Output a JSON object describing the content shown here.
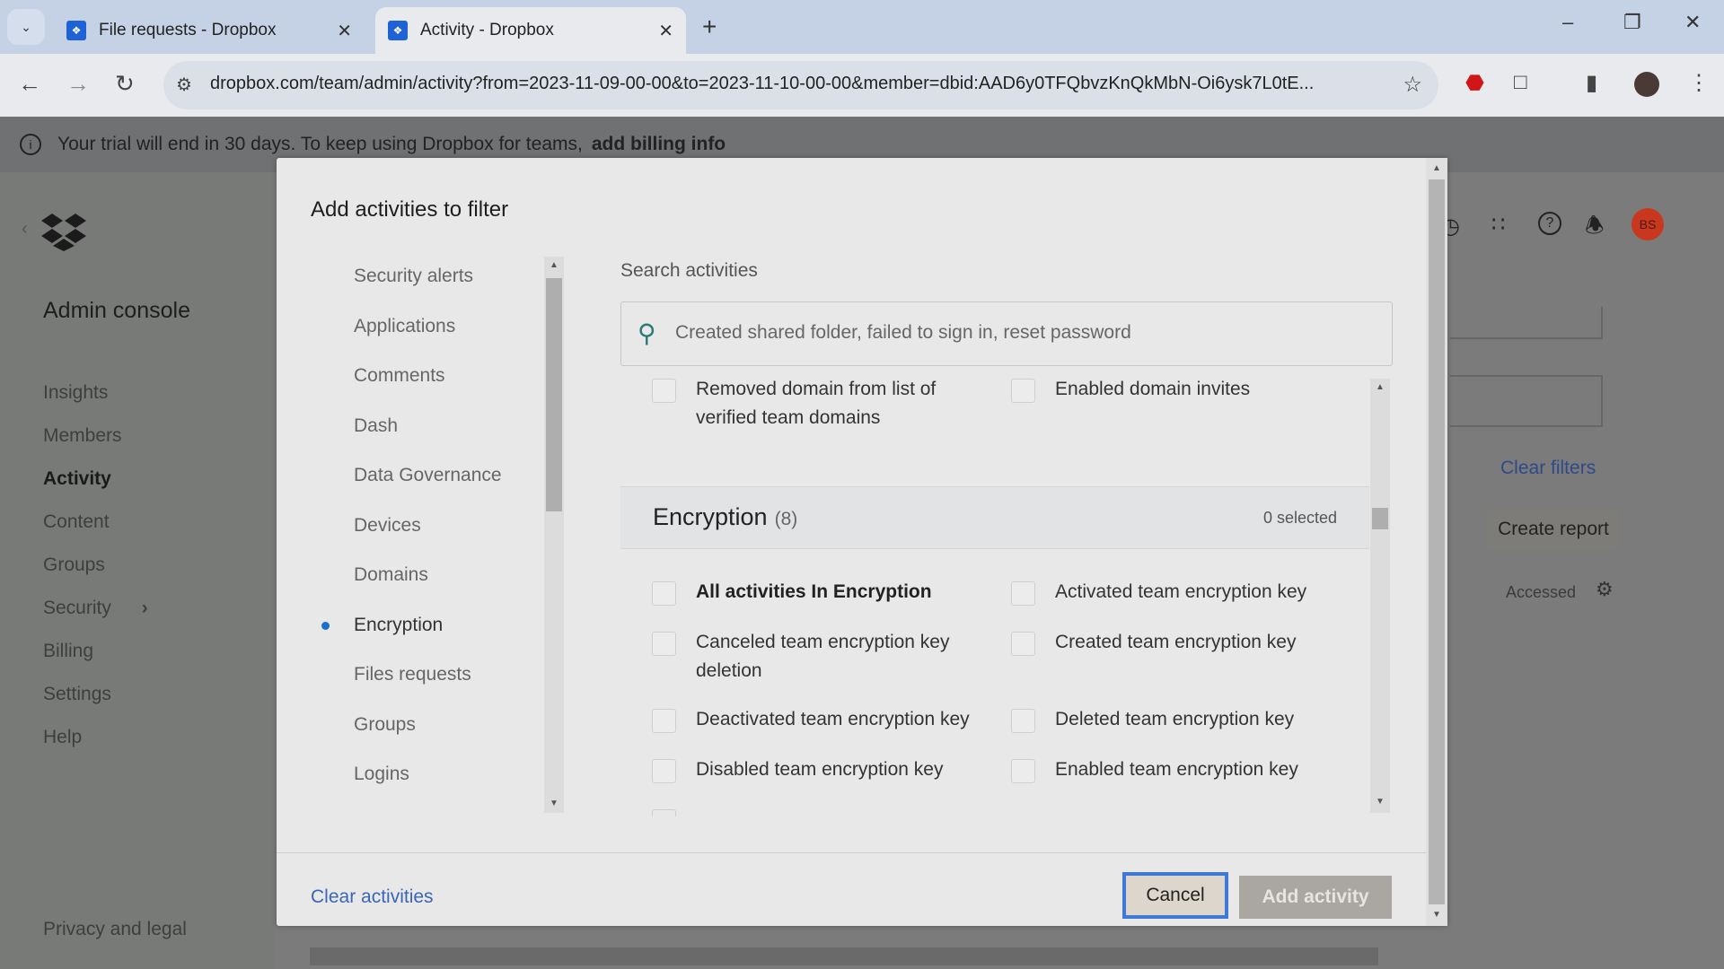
{
  "browser": {
    "tabs": [
      {
        "title": "File requests - Dropbox",
        "active": false
      },
      {
        "title": "Activity - Dropbox",
        "active": true
      }
    ],
    "url": "dropbox.com/team/admin/activity?from=2023-11-09-00-00&to=2023-11-10-00-00&member=dbid:AAD6y0TFQbvzKnQkMbN-Oi6ysk7L0tE..."
  },
  "banner": {
    "text": "Your trial will end in 30 days. To keep using Dropbox for teams,",
    "link": "add billing info"
  },
  "sidebar": {
    "title": "Admin console",
    "items": [
      {
        "label": "Insights"
      },
      {
        "label": "Members"
      },
      {
        "label": "Activity",
        "active": true
      },
      {
        "label": "Content"
      },
      {
        "label": "Groups"
      },
      {
        "label": "Security",
        "has_chevron": true
      },
      {
        "label": "Billing"
      },
      {
        "label": "Settings"
      },
      {
        "label": "Help"
      }
    ],
    "footer": "Privacy and legal"
  },
  "background_page": {
    "clear_filters": "Clear filters",
    "create_report": "Create report",
    "column_accessed": "Accessed",
    "avatar_initials": "BS",
    "avatar_color": "#c9371e"
  },
  "modal": {
    "title": "Add activities to filter",
    "categories": [
      {
        "label": "Security alerts"
      },
      {
        "label": "Applications"
      },
      {
        "label": "Comments"
      },
      {
        "label": "Dash"
      },
      {
        "label": "Data Governance"
      },
      {
        "label": "Devices"
      },
      {
        "label": "Domains"
      },
      {
        "label": "Encryption",
        "active": true
      },
      {
        "label": "Files requests"
      },
      {
        "label": "Groups"
      },
      {
        "label": "Logins"
      }
    ],
    "search": {
      "label": "Search activities",
      "placeholder": "Created shared folder, failed to sign in, reset password",
      "value": ""
    },
    "domain_items": [
      {
        "label": "Removed domain from list of verified team domains",
        "checked": false
      },
      {
        "label": "Enabled domain invites",
        "checked": false
      }
    ],
    "section": {
      "name": "Encryption",
      "count": "(8)",
      "selected": "0 selected"
    },
    "encryption_items": [
      {
        "label": "All activities In Encryption",
        "checked": false,
        "bold": true
      },
      {
        "label": "Activated team encryption key",
        "checked": false
      },
      {
        "label": "Canceled team encryption key deletion",
        "checked": false
      },
      {
        "label": "Created team encryption key",
        "checked": false
      },
      {
        "label": "Deactivated team encryption key",
        "checked": false
      },
      {
        "label": "Deleted team encryption key",
        "checked": false
      },
      {
        "label": "Disabled team encryption key",
        "checked": false
      },
      {
        "label": "Enabled team encryption key",
        "checked": false
      }
    ],
    "clear_activities": "Clear activities",
    "cancel_label": "Cancel",
    "add_label": "Add activity"
  }
}
